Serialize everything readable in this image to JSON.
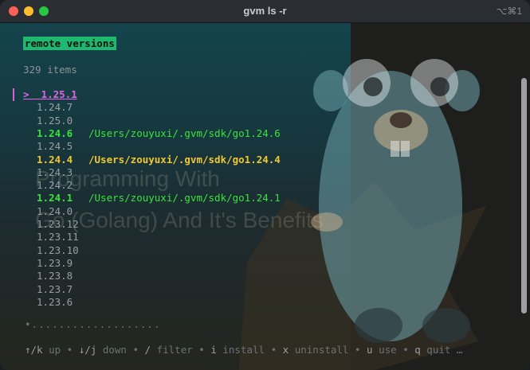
{
  "window": {
    "title": "gvm ls -r",
    "shortcut": "⌥⌘1"
  },
  "header": {
    "badge": "remote versions",
    "count": "329 items"
  },
  "versions": [
    {
      "label": ">  1.25.1",
      "path": "",
      "state": "selected"
    },
    {
      "label": "1.24.7",
      "path": "",
      "state": "normal"
    },
    {
      "label": "1.25.0",
      "path": "",
      "state": "normal"
    },
    {
      "label": "1.24.6",
      "path": "/Users/zouyuxi/.gvm/sdk/go1.24.6",
      "state": "installed"
    },
    {
      "label": "1.24.5",
      "path": "",
      "state": "normal"
    },
    {
      "label": "1.24.4",
      "path": "/Users/zouyuxi/.gvm/sdk/go1.24.4",
      "state": "current"
    },
    {
      "label": "1.24.3",
      "path": "",
      "state": "normal"
    },
    {
      "label": "1.24.2",
      "path": "",
      "state": "normal"
    },
    {
      "label": "1.24.1",
      "path": "/Users/zouyuxi/.gvm/sdk/go1.24.1",
      "state": "installed"
    },
    {
      "label": "1.24.0",
      "path": "",
      "state": "normal"
    },
    {
      "label": "1.23.12",
      "path": "",
      "state": "normal"
    },
    {
      "label": "1.23.11",
      "path": "",
      "state": "normal"
    },
    {
      "label": "1.23.10",
      "path": "",
      "state": "normal"
    },
    {
      "label": "1.23.9",
      "path": "",
      "state": "normal"
    },
    {
      "label": "1.23.8",
      "path": "",
      "state": "normal"
    },
    {
      "label": "1.23.7",
      "path": "",
      "state": "normal"
    },
    {
      "label": "1.23.6",
      "path": "",
      "state": "normal"
    }
  ],
  "pagination": "•...................",
  "help": [
    {
      "key": "↑/k",
      "desc": "up"
    },
    {
      "key": "↓/j",
      "desc": "down"
    },
    {
      "key": "/",
      "desc": "filter"
    },
    {
      "key": "i",
      "desc": "install"
    },
    {
      "key": "x",
      "desc": "uninstall"
    },
    {
      "key": "u",
      "desc": "use"
    },
    {
      "key": "q",
      "desc": "quit"
    }
  ],
  "help_more": "…",
  "colors": {
    "badge": "#1fb86f",
    "selected": "#e066e6",
    "installed": "#39e43a",
    "current": "#f0c832"
  }
}
